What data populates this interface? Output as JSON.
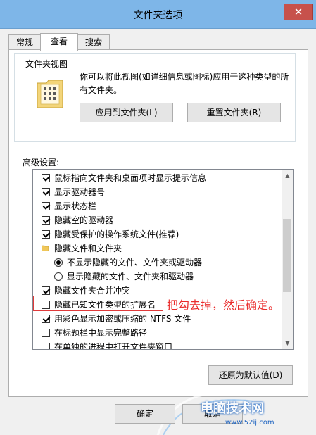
{
  "window": {
    "title": "文件夹选项",
    "close_glyph": "✕"
  },
  "tabs": [
    {
      "label": "常规"
    },
    {
      "label": "查看"
    },
    {
      "label": "搜索"
    }
  ],
  "folder_views": {
    "group_title": "文件夹视图",
    "description": "你可以将此视图(如详细信息或图标)应用于这种类型的所有文件夹。",
    "apply_button": "应用到文件夹(L)",
    "reset_button": "重置文件夹(R)"
  },
  "advanced": {
    "label": "高级设置:",
    "items": [
      {
        "type": "checkbox",
        "checked": true,
        "label": "鼠标指向文件夹和桌面项时显示提示信息"
      },
      {
        "type": "checkbox",
        "checked": true,
        "label": "显示驱动器号"
      },
      {
        "type": "checkbox",
        "checked": true,
        "label": "显示状态栏"
      },
      {
        "type": "checkbox",
        "checked": true,
        "label": "隐藏空的驱动器"
      },
      {
        "type": "checkbox",
        "checked": true,
        "label": "隐藏受保护的操作系统文件(推荐)"
      },
      {
        "type": "folder",
        "label": "隐藏文件和文件夹"
      },
      {
        "type": "radio",
        "checked": true,
        "label": "不显示隐藏的文件、文件夹或驱动器"
      },
      {
        "type": "radio",
        "checked": false,
        "label": "显示隐藏的文件、文件夹和驱动器"
      },
      {
        "type": "checkbox",
        "checked": true,
        "label": "隐藏文件夹合并冲突"
      },
      {
        "type": "checkbox",
        "checked": false,
        "label": "隐藏已知文件类型的扩展名"
      },
      {
        "type": "checkbox",
        "checked": true,
        "label": "用彩色显示加密或压缩的 NTFS 文件"
      },
      {
        "type": "checkbox",
        "checked": false,
        "label": "在标题栏中显示完整路径"
      },
      {
        "type": "checkbox",
        "checked": false,
        "label": "在单独的进程中打开文件夹窗口"
      }
    ],
    "restore_button": "还原为默认值(D)"
  },
  "annotation": "把勾去掉，然后确定。",
  "footer": {
    "ok_button": "确定",
    "cancel_button": "取消"
  },
  "watermark": {
    "text": "电脑技术网",
    "url": "www.52ij.com"
  },
  "colors": {
    "title_bar": "#7eb6e8",
    "close_button": "#c7514c",
    "annotation": "#ea2d2d"
  }
}
